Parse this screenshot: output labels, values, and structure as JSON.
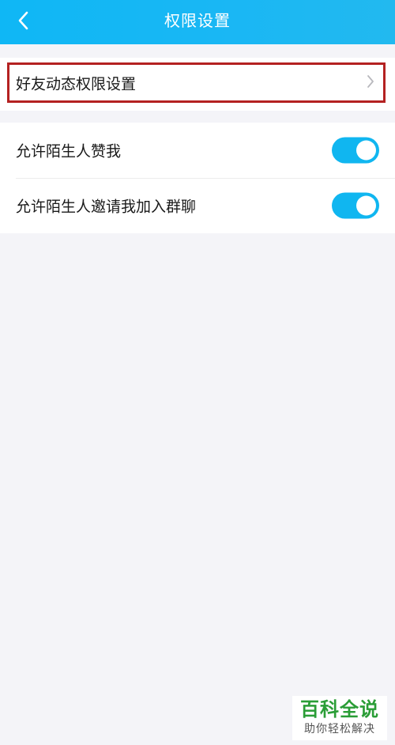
{
  "header": {
    "title": "权限设置",
    "back_icon": "chevron-left-icon",
    "bg_color": "#1ab7f4"
  },
  "friend_setting": {
    "label": "好友动态权限设置",
    "arrow_icon": "chevron-right-icon",
    "highlight_color": "#b42121"
  },
  "toggles": [
    {
      "label": "允许陌生人赞我",
      "on": true
    },
    {
      "label": "允许陌生人邀请我加入群聊",
      "on": true
    }
  ],
  "toggle_color": "#10b6f0",
  "watermark": {
    "main": "百科全说",
    "sub": "助你轻松解决"
  }
}
